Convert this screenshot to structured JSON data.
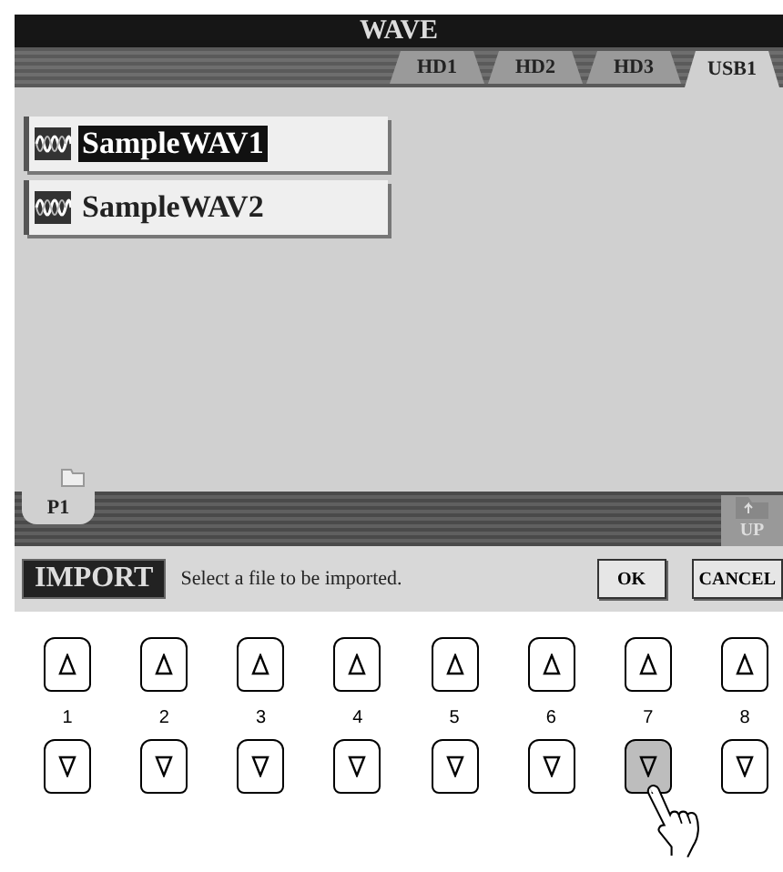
{
  "screen": {
    "title": "WAVE",
    "tabs": [
      {
        "label": "HD1",
        "selected": false
      },
      {
        "label": "HD2",
        "selected": false
      },
      {
        "label": "HD3",
        "selected": false
      },
      {
        "label": "USB1",
        "selected": true
      }
    ],
    "files": [
      {
        "name": "SampleWAV1",
        "selected": true
      },
      {
        "name": "SampleWAV2",
        "selected": false
      }
    ],
    "pages": [
      {
        "label": "P1",
        "selected": true
      }
    ],
    "up_button": "UP",
    "footer": {
      "mode": "IMPORT",
      "message": "Select a file to be imported.",
      "buttons": [
        "OK",
        "CANCEL"
      ]
    }
  },
  "panel_buttons": [
    {
      "number": "1",
      "pressed": false
    },
    {
      "number": "2",
      "pressed": false
    },
    {
      "number": "3",
      "pressed": false
    },
    {
      "number": "4",
      "pressed": false
    },
    {
      "number": "5",
      "pressed": false
    },
    {
      "number": "6",
      "pressed": false
    },
    {
      "number": "7",
      "pressed": true
    },
    {
      "number": "8",
      "pressed": false
    }
  ]
}
